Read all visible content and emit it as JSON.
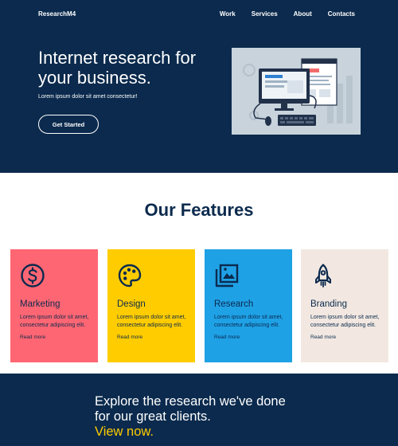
{
  "header": {
    "brand": "ResearchM4",
    "nav": [
      "Work",
      "Services",
      "About",
      "Contacts"
    ]
  },
  "hero": {
    "title": "Internet research for your business.",
    "subtitle": "Lorem ipsum dolor sit amet consectetur!",
    "cta_label": "Get Started"
  },
  "features": {
    "title": "Our Features",
    "cards": [
      {
        "title": "Marketing",
        "text": "Lorem ipsum dolor sit amet, consectetur adipiscing elit.",
        "link": "Read more",
        "icon": "dollar-icon",
        "color": "#ff6673"
      },
      {
        "title": "Design",
        "text": "Lorem ipsum dolor sit amet, consectetur adipiscing elit.",
        "link": "Read more",
        "icon": "palette-icon",
        "color": "#ffcc00"
      },
      {
        "title": "Research",
        "text": "Lorem ipsum dolor sit amet, consectetur adipiscing elit.",
        "link": "Read more",
        "icon": "chart-image-icon",
        "color": "#1fa1e6"
      },
      {
        "title": "Branding",
        "text": "Lorem ipsum dolor sit amet, consectetur adipiscing elit.",
        "link": "Read more",
        "icon": "rocket-icon",
        "color": "#f2e8e1"
      }
    ]
  },
  "cta": {
    "line1": "Explore the research we've done",
    "line2": "for our great clients.",
    "link": "View now."
  },
  "colors": {
    "navy": "#0b2a4d",
    "accent": "#ffcc00"
  }
}
